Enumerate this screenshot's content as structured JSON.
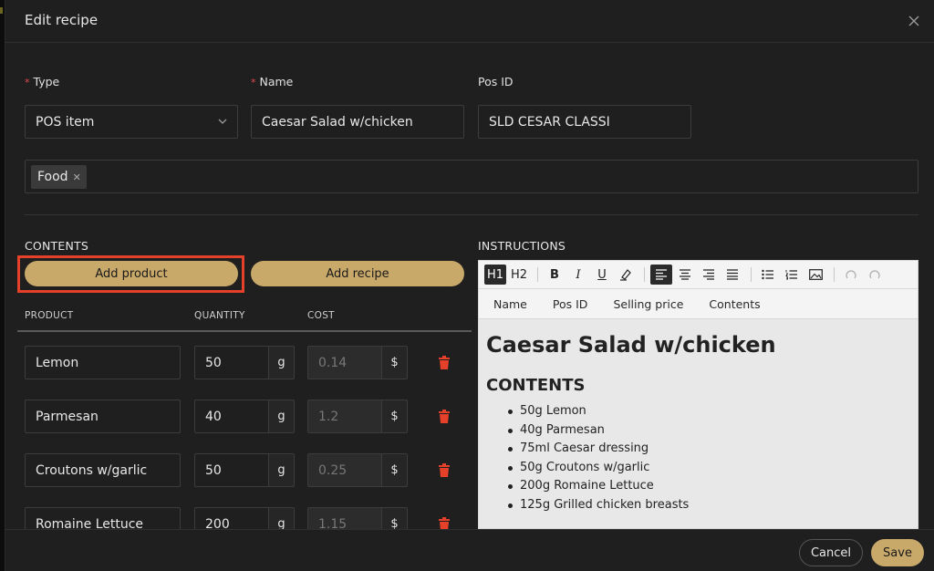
{
  "dialog": {
    "title": "Edit recipe"
  },
  "form": {
    "type": {
      "label": "Type",
      "value": "POS item"
    },
    "name": {
      "label": "Name",
      "value": "Caesar Salad w/chicken"
    },
    "pos_id": {
      "label": "Pos ID",
      "value": "SLD CESAR CLASSI"
    },
    "tags": [
      {
        "label": "Food"
      }
    ]
  },
  "contents": {
    "title": "CONTENTS",
    "add_product_label": "Add product",
    "add_recipe_label": "Add recipe",
    "columns": {
      "product": "PRODUCT",
      "quantity": "QUANTITY",
      "cost": "COST"
    },
    "rows": [
      {
        "product": "Lemon",
        "quantity": "50",
        "unit": "g",
        "cost": "0.14",
        "currency": "$"
      },
      {
        "product": "Parmesan",
        "quantity": "40",
        "unit": "g",
        "cost": "1.2",
        "currency": "$"
      },
      {
        "product": "Croutons w/garlic",
        "quantity": "50",
        "unit": "g",
        "cost": "0.25",
        "currency": "$"
      },
      {
        "product": "Romaine Lettuce",
        "quantity": "200",
        "unit": "g",
        "cost": "1.15",
        "currency": "$"
      }
    ]
  },
  "instructions": {
    "title": "INSTRUCTIONS",
    "toolbar": {
      "h1": "H1",
      "h2": "H2",
      "bold": "B",
      "italic": "I",
      "underline": "U"
    },
    "tabs": [
      "Name",
      "Pos ID",
      "Selling price",
      "Contents"
    ],
    "heading": "Caesar Salad w/chicken",
    "subheading": "CONTENTS",
    "items": [
      "50g Lemon",
      "40g Parmesan",
      "75ml Caesar dressing",
      "50g Croutons w/garlic",
      "200g Romaine Lettuce",
      "125g Grilled chicken breasts"
    ]
  },
  "footer": {
    "cancel_label": "Cancel",
    "save_label": "Save"
  },
  "colors": {
    "accent": "#c9a96a",
    "required": "#e5484d",
    "danger": "#e4402a"
  }
}
